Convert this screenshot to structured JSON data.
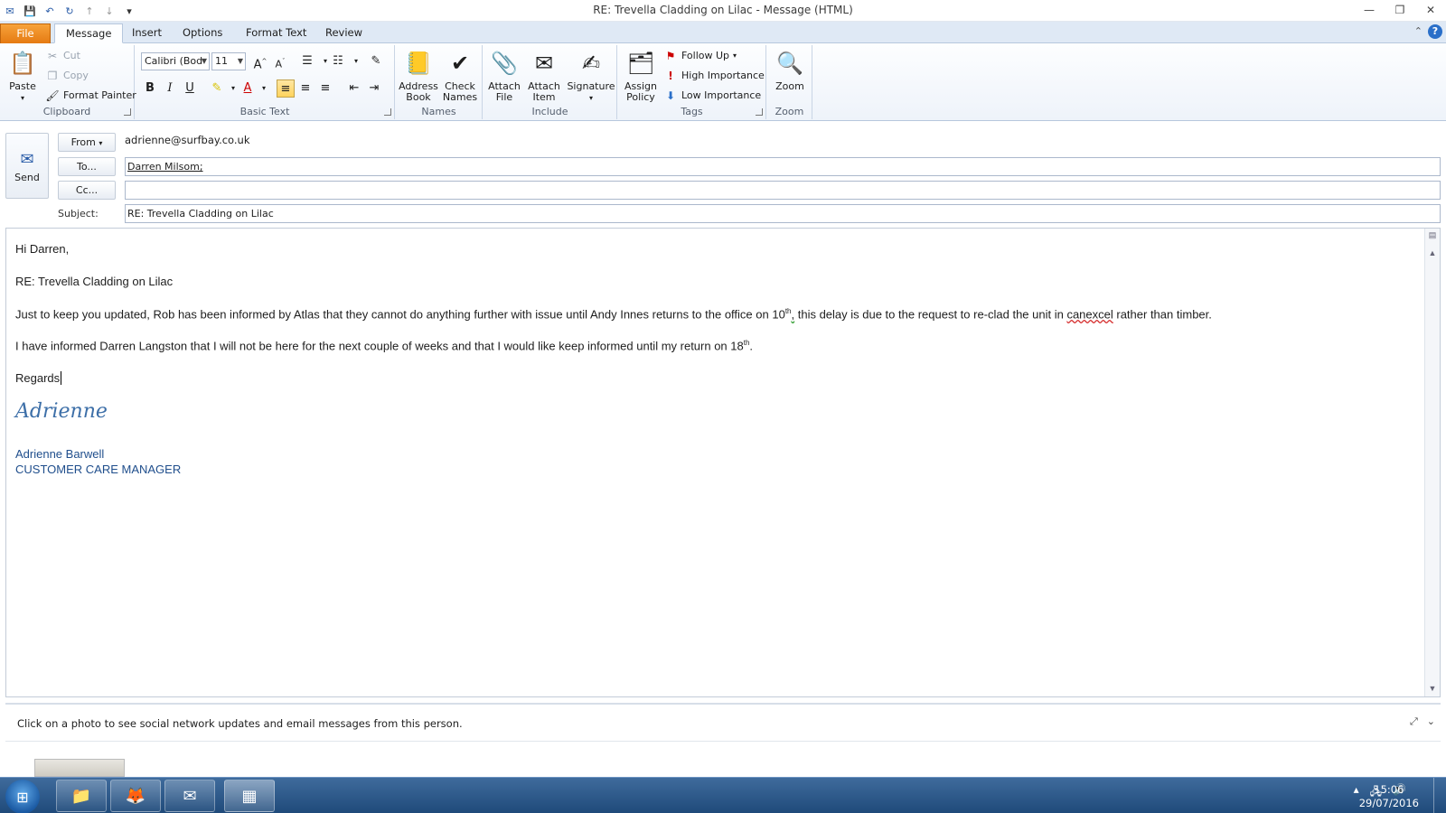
{
  "window": {
    "title": "RE: Trevella Cladding on Lilac  -  Message (HTML)"
  },
  "ribbon": {
    "tabs": [
      "File",
      "Message",
      "Insert",
      "Options",
      "Format Text",
      "Review"
    ],
    "clipboard": {
      "paste": "Paste",
      "cut": "Cut",
      "copy": "Copy",
      "format_painter": "Format Painter",
      "group_label": "Clipboard"
    },
    "basic_text": {
      "font_name": "Calibri (Bod",
      "font_size": "11",
      "group_label": "Basic Text"
    },
    "names": {
      "address_book": "Address Book",
      "check_names": "Check Names",
      "group_label": "Names"
    },
    "include": {
      "attach_file": "Attach File",
      "attach_item": "Attach Item",
      "signature": "Signature",
      "group_label": "Include"
    },
    "tags": {
      "assign_policy": "Assign Policy",
      "follow_up": "Follow Up",
      "high_importance": "High Importance",
      "low_importance": "Low Importance",
      "group_label": "Tags"
    },
    "zoom": {
      "zoom": "Zoom",
      "group_label": "Zoom"
    }
  },
  "header": {
    "send_label": "Send",
    "from_button": "From",
    "from_value": "adrienne@surfbay.co.uk",
    "to_button": "To...",
    "to_value": "Darren Milsom;",
    "cc_button": "Cc...",
    "cc_value": "",
    "subject_label": "Subject:",
    "subject_value": "RE: Trevella Cladding on Lilac"
  },
  "body": {
    "greeting": "Hi Darren,",
    "re_line": "RE: Trevella Cladding on Lilac",
    "para1_a": "Just to keep you updated, Rob has been informed by Atlas that they cannot do anything further with issue until Andy Innes returns to the office on 10",
    "para1_sup": "th",
    "para1_b": ",",
    "para1_c": "  this delay is due to the request to re-clad the unit in ",
    "para1_misspelled": "canexcel",
    "para1_d": " rather than timber.",
    "para2_a": "I have informed Darren Langston that I will not be here for the next couple of weeks and that I would like keep informed until my return on 18",
    "para2_sup": "th",
    "para2_b": ".",
    "regards": "Regards",
    "signature_script": "Adrienne",
    "signature_name": "Adrienne Barwell",
    "signature_title": "CUSTOMER CARE MANAGER"
  },
  "people_pane": {
    "message": "Click on a photo to see social network updates and email messages from this person."
  },
  "taskbar": {
    "time": "15:06",
    "date": "29/07/2016"
  },
  "colors": {
    "file_tab": "#e57a12",
    "ribbon_bg": "#eef3fa",
    "signature_blue": "#1f4e8c",
    "taskbar": "#1f4a7a"
  }
}
